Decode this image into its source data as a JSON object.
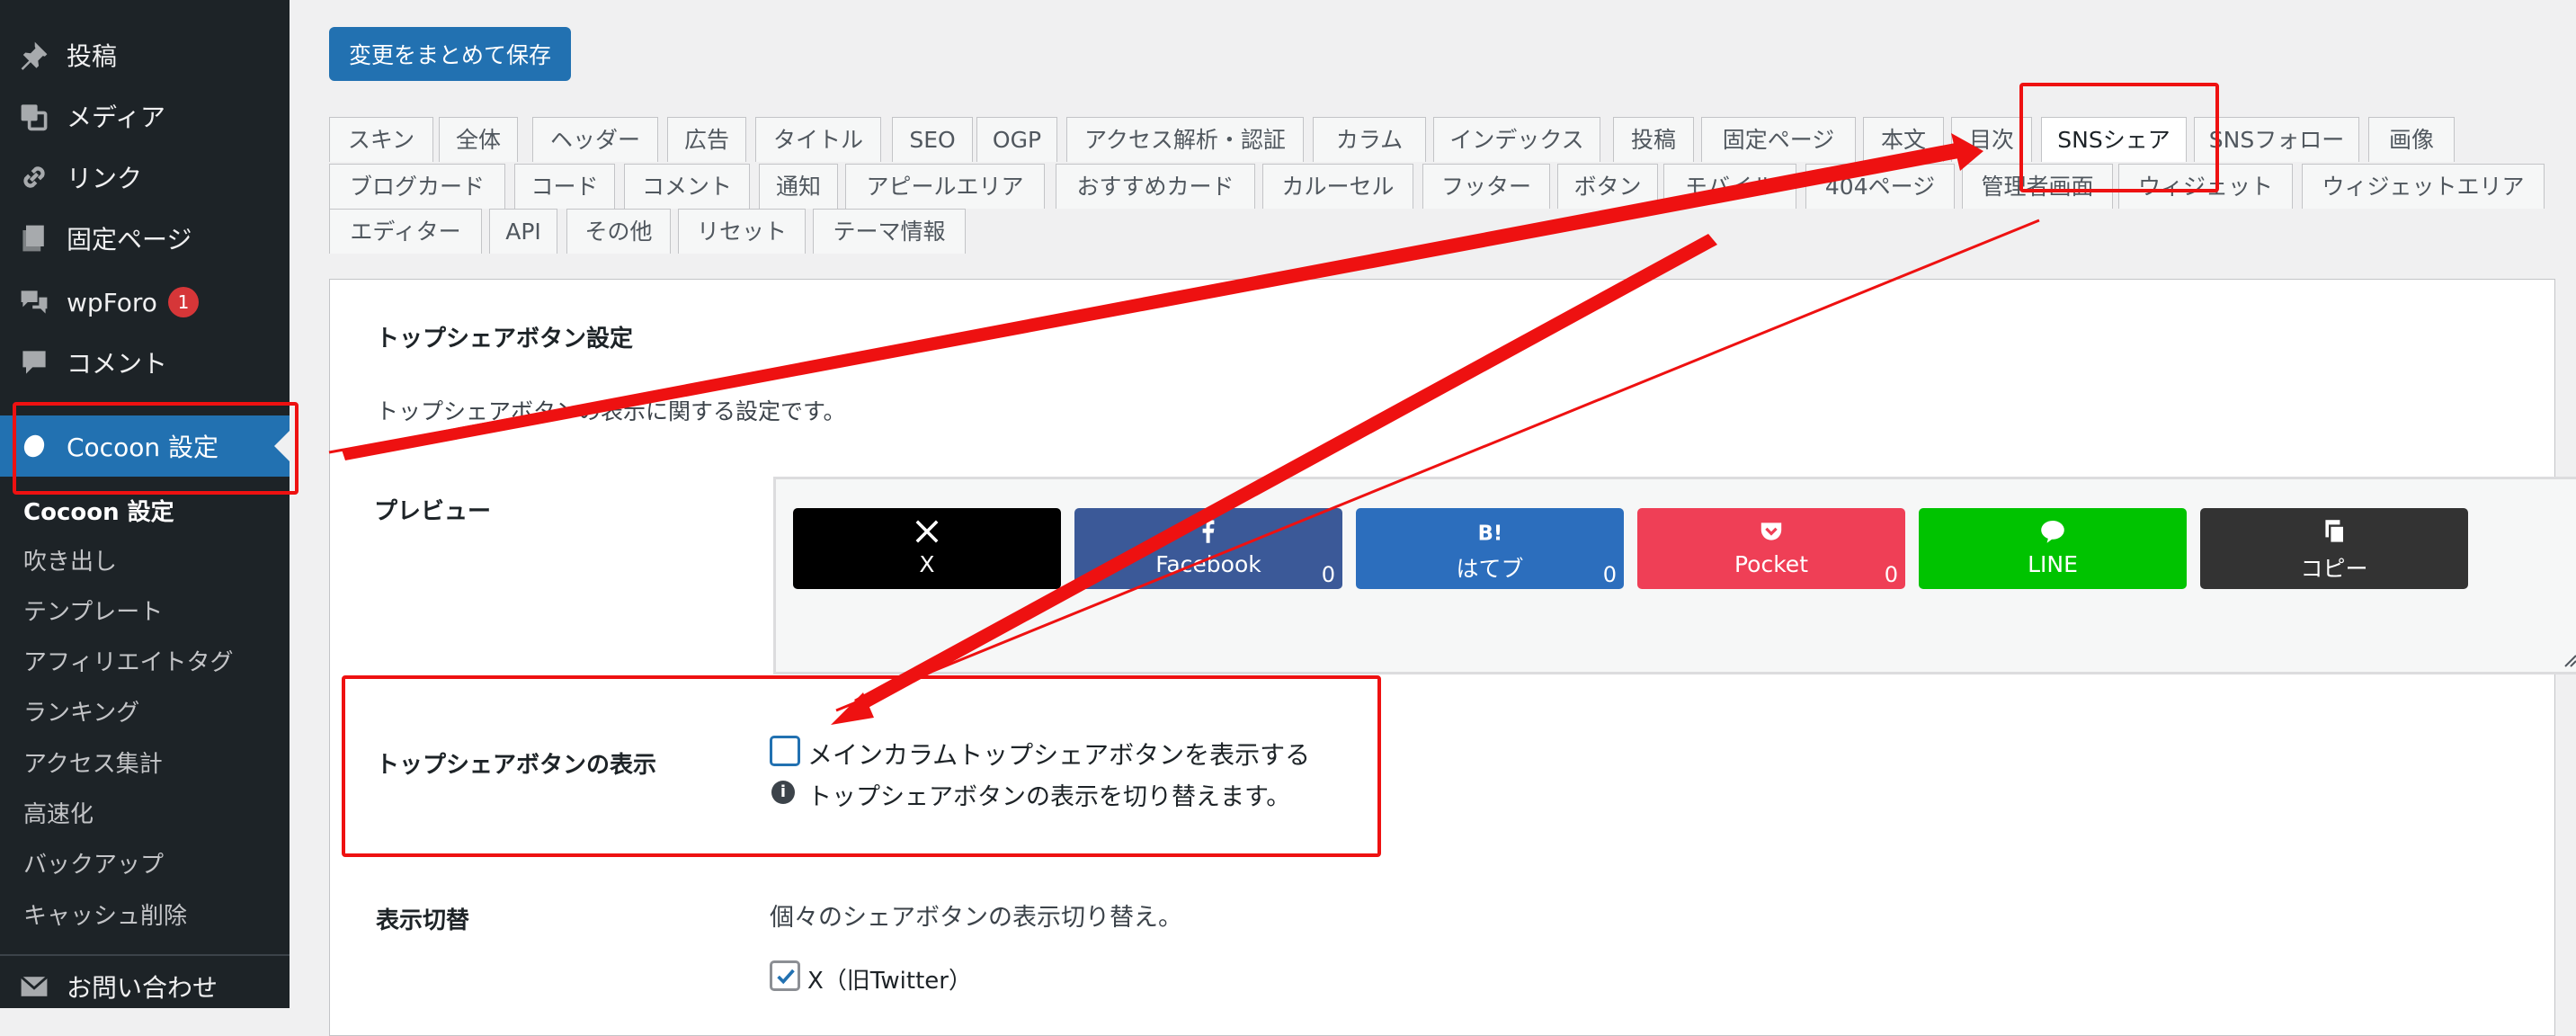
{
  "sidebar": {
    "items": [
      {
        "label": "投稿",
        "icon": "pin-icon"
      },
      {
        "label": "メディア",
        "icon": "media-icon"
      },
      {
        "label": "リンク",
        "icon": "link-icon"
      },
      {
        "label": "固定ページ",
        "icon": "pages-icon"
      },
      {
        "label": "wpForo",
        "icon": "forum-icon",
        "badge": "1"
      },
      {
        "label": "コメント",
        "icon": "comment-icon"
      },
      {
        "label": "Cocoon 設定",
        "icon": "cocoon-icon",
        "active": true
      }
    ],
    "submenu": [
      "Cocoon 設定",
      "吹き出し",
      "テンプレート",
      "アフィリエイトタグ",
      "ランキング",
      "アクセス集計",
      "高速化",
      "バックアップ",
      "キャッシュ削除"
    ],
    "last_item": {
      "label": "お問い合わせ",
      "icon": "mail-icon"
    }
  },
  "toolbar": {
    "save_label": "変更をまとめて保存"
  },
  "tabs": {
    "row1": [
      "スキン",
      "全体",
      "ヘッダー",
      "広告",
      "タイトル",
      "SEO",
      "OGP",
      "アクセス解析・認証",
      "カラム",
      "インデックス",
      "投稿",
      "固定ページ",
      "本文",
      "目次",
      "SNSシェア",
      "SNSフォロー",
      "画像"
    ],
    "row2": [
      "ブログカード",
      "コード",
      "コメント",
      "通知",
      "アピールエリア",
      "おすすめカード",
      "カルーセル",
      "フッター",
      "ボタン",
      "モバイル",
      "404ページ",
      "管理者画面",
      "ウィジェット",
      "ウィジェットエリア"
    ],
    "row3": [
      "エディター",
      "API",
      "その他",
      "リセット",
      "テーマ情報"
    ],
    "active": "SNSシェア"
  },
  "section": {
    "title": "トップシェアボタン設定",
    "description": "トップシェアボタンの表示に関する設定です。",
    "preview_label": "プレビュー",
    "share_buttons": [
      {
        "label": "X",
        "icon": "x-icon",
        "color": "#000000",
        "count": ""
      },
      {
        "label": "Facebook",
        "icon": "facebook-icon",
        "color": "#3b5998",
        "count": "0"
      },
      {
        "label": "はてブ",
        "icon": "hatena-icon",
        "color": "#2c6ebd",
        "count": "0"
      },
      {
        "label": "Pocket",
        "icon": "pocket-icon",
        "color": "#ef3f56",
        "count": "0"
      },
      {
        "label": "LINE",
        "icon": "line-icon",
        "color": "#00c300",
        "count": ""
      },
      {
        "label": "コピー",
        "icon": "copy-icon",
        "color": "#333333",
        "count": ""
      }
    ],
    "display_label": "トップシェアボタンの表示",
    "display_checkbox_label": "メインカラムトップシェアボタンを表示する",
    "display_help": "トップシェアボタンの表示を切り替えます。",
    "toggle_label": "表示切替",
    "toggle_description": "個々のシェアボタンの表示切り替え。",
    "toggle_x_label": "X（旧Twitter）"
  },
  "annotation_color": "#ee1111"
}
